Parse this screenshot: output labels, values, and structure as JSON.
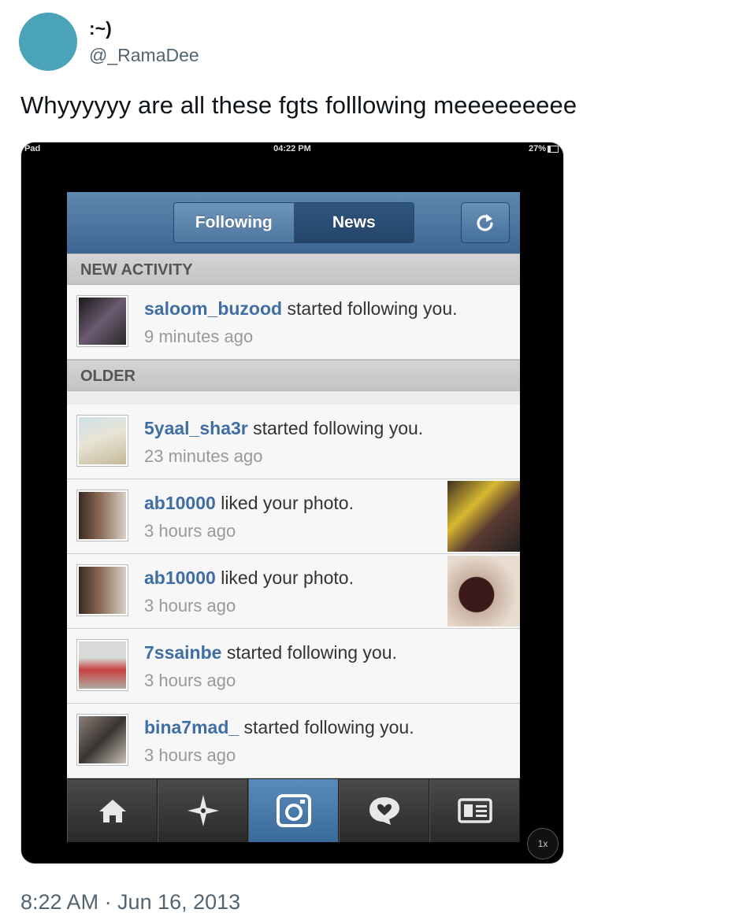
{
  "author": {
    "display_name": ":~)",
    "handle": "@_RamaDee"
  },
  "tweet": {
    "text": "Whyyyyyy are all these fgts folllowing meeeeeeeee",
    "timestamp": "8:22 AM · Jun 16, 2013"
  },
  "screenshot": {
    "status_bar": {
      "carrier": "Pad",
      "time": "04:22 PM",
      "battery": "27%"
    },
    "segments": {
      "following": "Following",
      "news": "News"
    },
    "sections": {
      "new": "NEW ACTIVITY",
      "older": "OLDER"
    },
    "activities": [
      {
        "user": "saloom_buzood",
        "action": " started following you.",
        "time": "9 minutes ago"
      },
      {
        "user": "5yaal_sha3r",
        "action": " started following you.",
        "time": "23 minutes ago"
      },
      {
        "user": "ab10000",
        "action": " liked your photo.",
        "time": "3 hours ago"
      },
      {
        "user": "ab10000",
        "action": " liked your photo.",
        "time": "3 hours ago"
      },
      {
        "user": "7ssainbe",
        "action": " started following you.",
        "time": "3 hours ago"
      },
      {
        "user": "bina7mad_",
        "action": " started following you.",
        "time": "3 hours ago"
      }
    ],
    "tabs": [
      "home-icon",
      "explore-icon",
      "camera-icon",
      "activity-icon",
      "profile-icon"
    ],
    "zoom_badge": "1x"
  }
}
